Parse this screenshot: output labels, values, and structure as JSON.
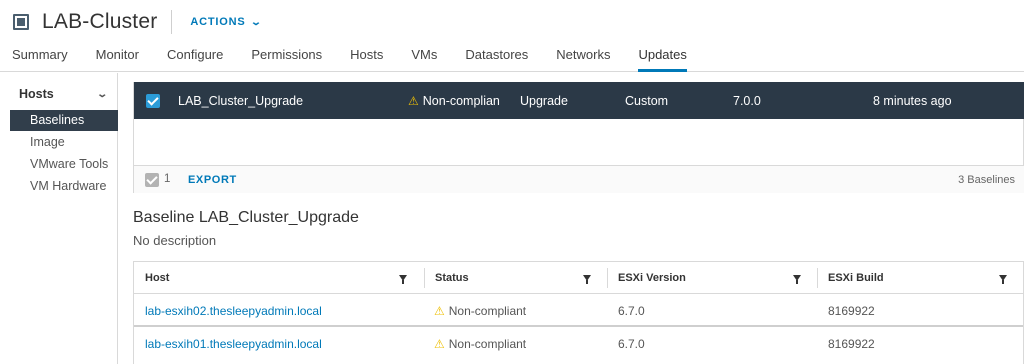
{
  "header": {
    "title": "LAB-Cluster",
    "actions_label": "ACTIONS"
  },
  "tabs": [
    "Summary",
    "Monitor",
    "Configure",
    "Permissions",
    "Hosts",
    "VMs",
    "Datastores",
    "Networks",
    "Updates"
  ],
  "active_tab": "Updates",
  "sidebar": {
    "section": "Hosts",
    "items": [
      "Baselines",
      "Image",
      "VMware Tools",
      "VM Hardware"
    ],
    "active_item": "Baselines"
  },
  "baselines_grid": {
    "selected_row": {
      "name": "LAB_Cluster_Upgrade",
      "status": "Non-complian",
      "type": "Upgrade",
      "origin": "Custom",
      "version": "7.0.0",
      "modified": "8 minutes ago"
    },
    "footer": {
      "selected_count": "1",
      "export_label": "EXPORT",
      "total_label": "3 Baselines"
    }
  },
  "baseline_detail": {
    "title": "Baseline LAB_Cluster_Upgrade",
    "description": "No description"
  },
  "hosts_grid": {
    "columns": [
      "Host",
      "Status",
      "ESXi Version",
      "ESXi Build"
    ],
    "rows": [
      {
        "host": "lab-esxih02.thesleepyadmin.local",
        "status": "Non-compliant",
        "version": "6.7.0",
        "build": "8169922"
      },
      {
        "host": "lab-esxih01.thesleepyadmin.local",
        "status": "Non-compliant",
        "version": "6.7.0",
        "build": "8169922"
      }
    ]
  },
  "colors": {
    "accent": "#0079b8",
    "selected_row_bg": "#2b3947",
    "sidebar_active_bg": "#313e4b",
    "warning": "#efc006"
  },
  "icons": {
    "cluster": "cluster-icon",
    "warning": "warning-icon",
    "filter": "filter-icon",
    "chevron": "chevron-down-icon"
  }
}
